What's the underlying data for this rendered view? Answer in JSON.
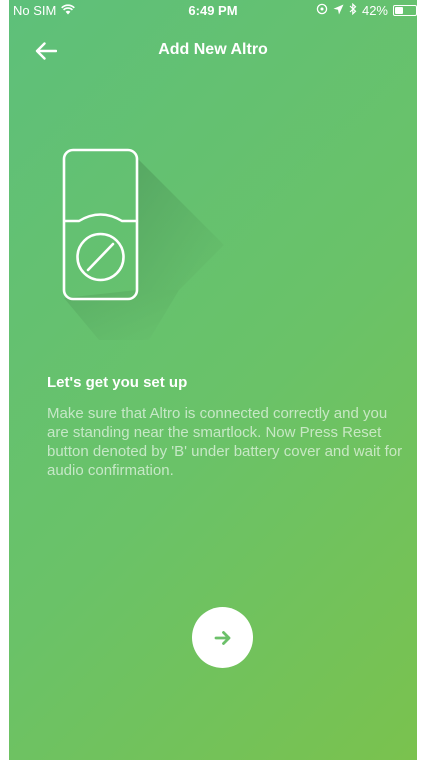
{
  "status_bar": {
    "carrier": "No SIM",
    "time": "6:49 PM",
    "battery_percent": "42%",
    "battery_level": 0.42,
    "icons": [
      "wifi-icon",
      "location-icon",
      "bluetooth-icon",
      "alarm-icon",
      "battery-icon"
    ]
  },
  "header": {
    "title": "Add New Altro",
    "back_icon": "arrow-left-icon"
  },
  "illustration": {
    "icon": "smartlock-icon"
  },
  "content": {
    "title": "Let's get you set up",
    "description": "Make sure that Altro is connected correctly and you are standing near the smartlock. Now Press Reset button denoted by 'B' under battery cover and wait for audio confirmation."
  },
  "next_button": {
    "icon": "arrow-right-icon"
  },
  "colors": {
    "gradient_start": "#5ec07a",
    "gradient_end": "#7ac24e",
    "button_bg": "#ffffff",
    "button_icon": "#6cc06a"
  }
}
